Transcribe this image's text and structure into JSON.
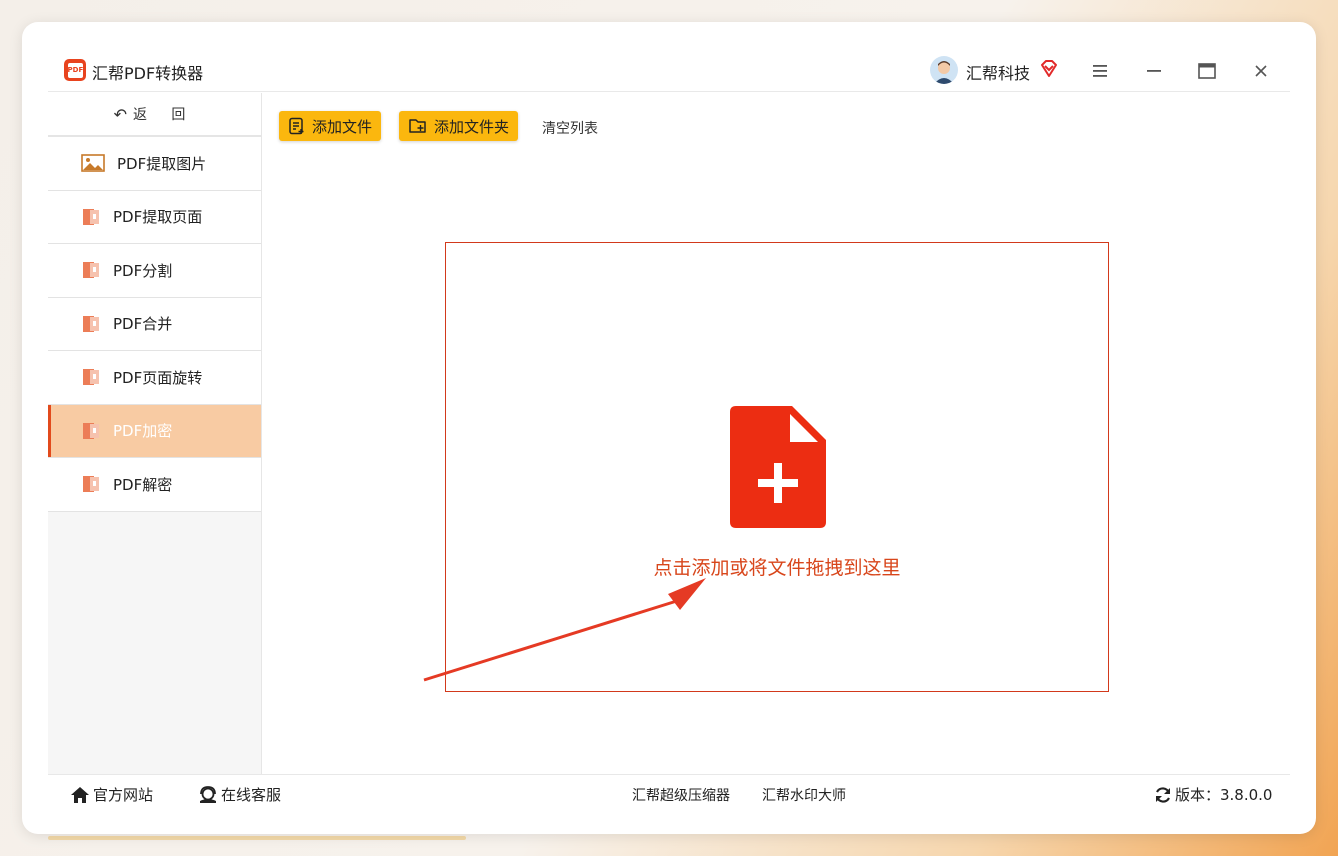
{
  "app": {
    "title": "汇帮PDF转换器",
    "user_name": "汇帮科技"
  },
  "titlebar": {
    "menu_icon": "menu-icon",
    "minimize_icon": "minimize-icon",
    "maximize_icon": "maximize-icon",
    "close_icon": "close-icon"
  },
  "sidebar": {
    "back_label": "返 回",
    "items": [
      {
        "label": "PDF提取图片",
        "icon": "image-icon",
        "active": false
      },
      {
        "label": "PDF提取页面",
        "icon": "pdf-file-icon",
        "active": false
      },
      {
        "label": "PDF分割",
        "icon": "pdf-file-icon",
        "active": false
      },
      {
        "label": "PDF合并",
        "icon": "pdf-file-icon",
        "active": false
      },
      {
        "label": "PDF页面旋转",
        "icon": "pdf-file-icon",
        "active": false
      },
      {
        "label": "PDF加密",
        "icon": "pdf-file-icon",
        "active": true
      },
      {
        "label": "PDF解密",
        "icon": "pdf-file-icon",
        "active": false
      }
    ]
  },
  "toolbar": {
    "add_file_label": "添加文件",
    "add_folder_label": "添加文件夹",
    "clear_list_label": "清空列表"
  },
  "dropzone": {
    "hint": "点击添加或将文件拖拽到这里"
  },
  "footer": {
    "official_site": "官方网站",
    "online_service": "在线客服",
    "compressor_link": "汇帮超级压缩器",
    "watermark_link": "汇帮水印大师",
    "version_label": "版本：3.8.0.0"
  },
  "colors": {
    "accent": "#fbb70e",
    "active_item_bg": "#f8cba3",
    "drop_red": "#e8321a"
  }
}
